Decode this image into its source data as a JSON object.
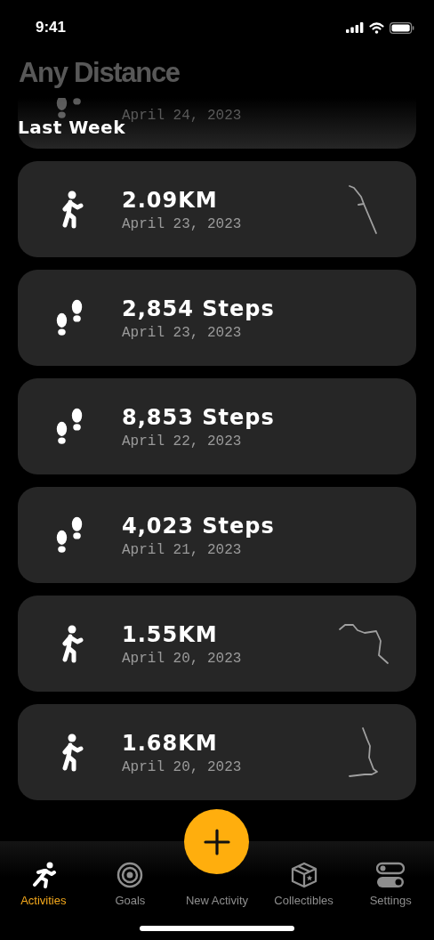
{
  "status_bar": {
    "time": "9:41"
  },
  "app_title": "Any Distance",
  "section_header": "Last Week",
  "activities": [
    {
      "kind": "steps",
      "date": "April 24, 2023"
    },
    {
      "kind": "walk",
      "title": "2.09KM",
      "date": "April 23, 2023"
    },
    {
      "kind": "steps",
      "title": "2,854 Steps",
      "date": "April 23, 2023"
    },
    {
      "kind": "steps",
      "title": "8,853 Steps",
      "date": "April 22, 2023"
    },
    {
      "kind": "steps",
      "title": "4,023 Steps",
      "date": "April 21, 2023"
    },
    {
      "kind": "walk",
      "title": "1.55KM",
      "date": "April 20, 2023"
    },
    {
      "kind": "walk",
      "title": "1.68KM",
      "date": "April 20, 2023"
    }
  ],
  "tabs": [
    {
      "label": "Activities",
      "selected": true
    },
    {
      "label": "Goals",
      "selected": false
    },
    {
      "label": "New Activity",
      "selected": false
    },
    {
      "label": "Collectibles",
      "selected": false
    },
    {
      "label": "Settings",
      "selected": false
    }
  ]
}
